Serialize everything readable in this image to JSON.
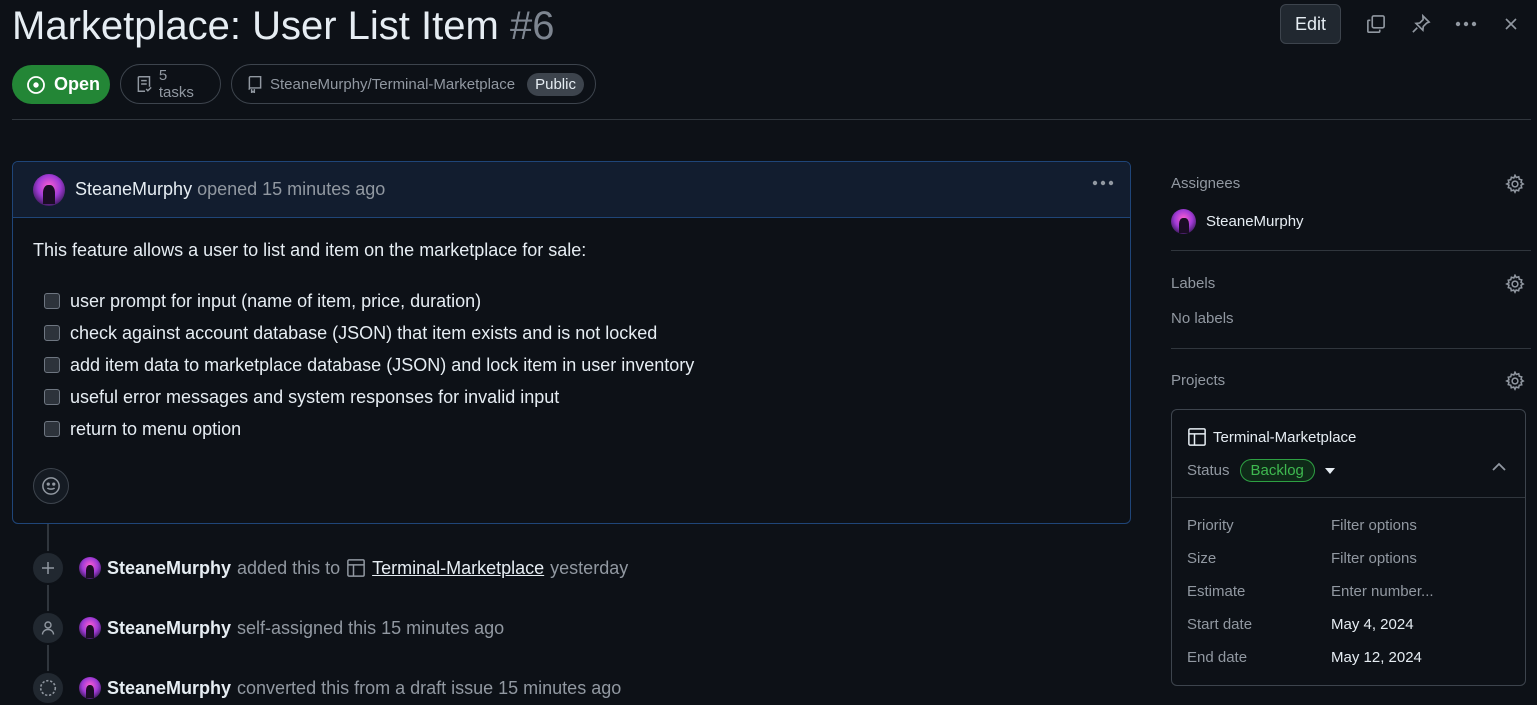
{
  "header": {
    "title": "Marketplace: User List Item",
    "number": "#6",
    "edit_label": "Edit",
    "status_label": "Open",
    "tasks_label": "5 tasks",
    "repo_label": "SteaneMurphy/Terminal-Marketplace",
    "visibility_label": "Public",
    "status_color": "#238636"
  },
  "comment": {
    "author": "SteaneMurphy",
    "action": "opened 15 minutes ago",
    "body": "This feature allows a user to list and item on the marketplace for sale:",
    "tasks": [
      "user prompt for input (name of item, price, duration)",
      "check against account database (JSON) that item exists and is not locked",
      "add item data to marketplace database (JSON) and lock item in user inventory",
      "useful error messages and system responses for invalid input",
      "return to menu option"
    ]
  },
  "timeline": [
    {
      "icon": "plus-icon",
      "user": "SteaneMurphy",
      "pre": "added this to",
      "link": "Terminal-Marketplace",
      "post": "yesterday"
    },
    {
      "icon": "person-icon",
      "user": "SteaneMurphy",
      "pre": "self-assigned this 15 minutes ago"
    },
    {
      "icon": "draft-circle-icon",
      "user": "SteaneMurphy",
      "pre": "converted this from a draft issue 15 minutes ago"
    }
  ],
  "sidebar": {
    "assignees_title": "Assignees",
    "assignee": "SteaneMurphy",
    "labels_title": "Labels",
    "labels_value": "No labels",
    "projects_title": "Projects",
    "project": {
      "name": "Terminal-Marketplace",
      "status_label": "Status",
      "status_value": "Backlog",
      "fields": [
        {
          "key": "Priority",
          "value": "Filter options",
          "set": false
        },
        {
          "key": "Size",
          "value": "Filter options",
          "set": false
        },
        {
          "key": "Estimate",
          "value": "Enter number...",
          "set": false
        },
        {
          "key": "Start date",
          "value": "May 4, 2024",
          "set": true
        },
        {
          "key": "End date",
          "value": "May 12, 2024",
          "set": true
        }
      ]
    }
  }
}
